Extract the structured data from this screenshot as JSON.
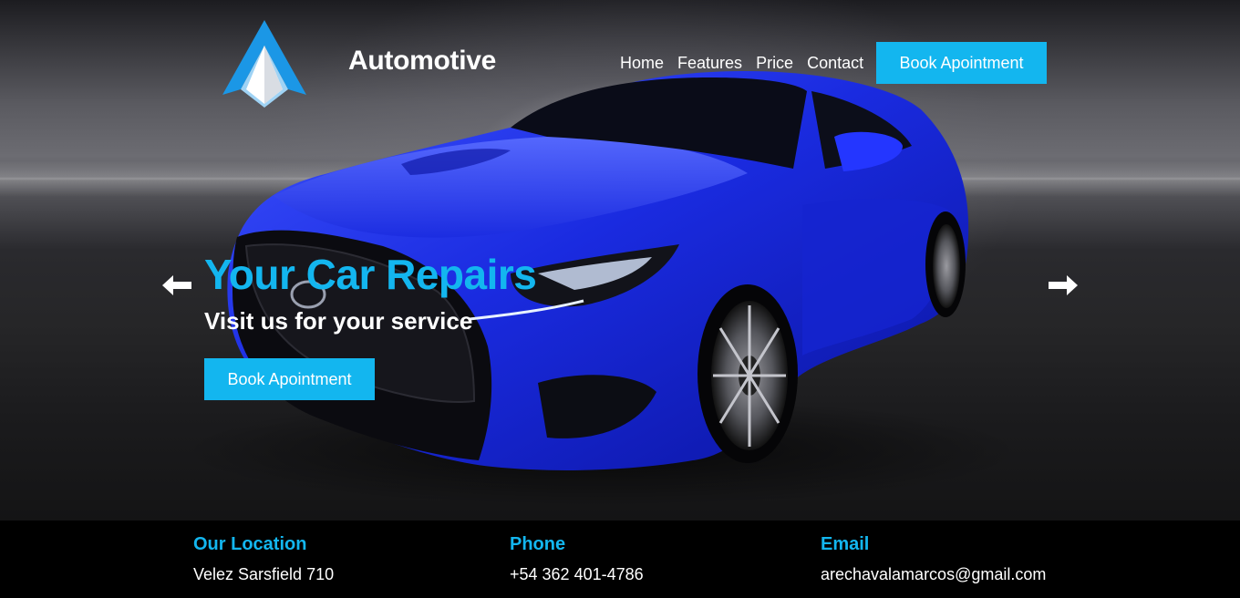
{
  "header": {
    "brand": "Automotive",
    "nav": [
      "Home",
      "Features",
      "Price",
      "Contact"
    ],
    "cta": "Book Apointment"
  },
  "hero": {
    "title": "Your Car Repairs",
    "subtitle": "Visit us for your service",
    "cta": "Book Apointment",
    "prev_icon": "arrow-left-icon",
    "next_icon": "arrow-right-icon"
  },
  "info": [
    {
      "label": "Our Location",
      "value": "Velez Sarsfield 710"
    },
    {
      "label": "Phone",
      "value": "+54 362 401-4786"
    },
    {
      "label": "Email",
      "value": "arechavalamarcos@gmail.com"
    }
  ],
  "colors": {
    "accent": "#13b6ef",
    "car_blue": "#1a2be0",
    "background": "#000000"
  }
}
